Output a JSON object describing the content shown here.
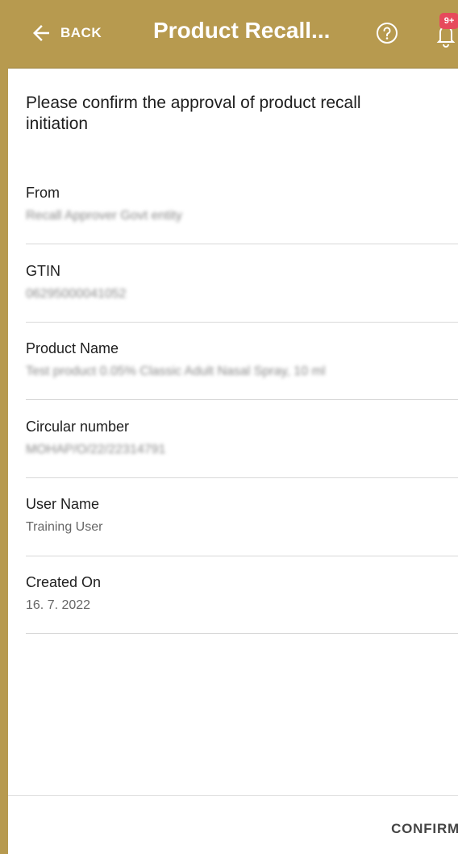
{
  "app_bar": {
    "back_label": "BACK",
    "title": "Product Recall...",
    "notification_badge": "9+",
    "accent_color": "#b79a4f"
  },
  "intro_text": "Please confirm the approval of product recall initiation",
  "fields": [
    {
      "label": "From",
      "value": "Recall Approver Govt entity"
    },
    {
      "label": "GTIN",
      "value": "06295000041052"
    },
    {
      "label": "Product Name",
      "value": "Test product 0.05% Classic Adult Nasal Spray, 10 ml"
    },
    {
      "label": "Circular number",
      "value": "MOHAP/O/22/22314791"
    },
    {
      "label": "User Name",
      "value": "Training User"
    },
    {
      "label": "Created On",
      "value": "16. 7. 2022"
    }
  ],
  "footer": {
    "confirm_label": "CONFIRM"
  }
}
